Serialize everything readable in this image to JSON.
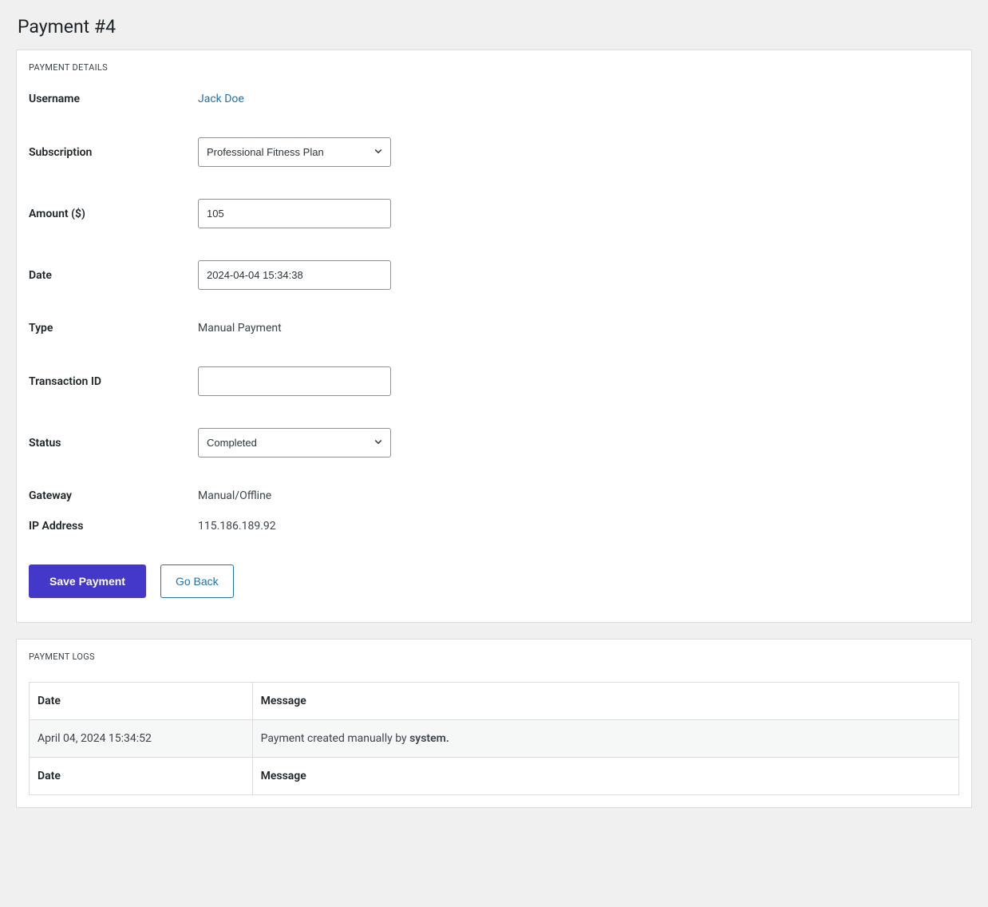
{
  "page_title": "Payment #4",
  "details": {
    "panel_title": "PAYMENT DETAILS",
    "labels": {
      "username": "Username",
      "subscription": "Subscription",
      "amount": "Amount ($)",
      "date": "Date",
      "type": "Type",
      "transaction_id": "Transaction ID",
      "status": "Status",
      "gateway": "Gateway",
      "ip": "IP Address"
    },
    "values": {
      "username": "Jack Doe",
      "subscription_selected": "Professional Fitness Plan",
      "amount": "105",
      "date": "2024-04-04 15:34:38",
      "type": "Manual Payment",
      "transaction_id": "",
      "status_selected": "Completed",
      "gateway": "Manual/Offline",
      "ip": "115.186.189.92"
    }
  },
  "buttons": {
    "save": "Save Payment",
    "back": "Go Back"
  },
  "logs": {
    "panel_title": "PAYMENT LOGS",
    "headers": {
      "date": "Date",
      "message": "Message"
    },
    "rows": [
      {
        "date": "April 04, 2024 15:34:52",
        "message_prefix": "Payment created manually by ",
        "message_bold": "system."
      }
    ]
  }
}
